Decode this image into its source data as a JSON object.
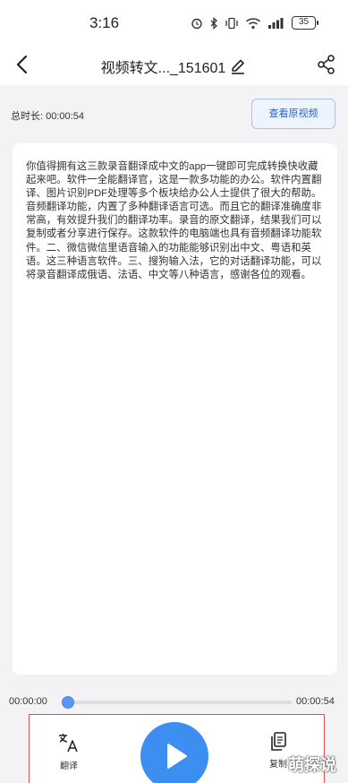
{
  "status_bar": {
    "time": "3:16",
    "icons": [
      "alarm-icon",
      "bluetooth-icon",
      "vibrate-icon",
      "wifi-icon",
      "signal-icon"
    ],
    "battery": "35"
  },
  "header": {
    "title": "视频转文..._151601",
    "icons": [
      "back-arrow-icon",
      "edit-pencil-icon",
      "share-icon"
    ]
  },
  "info": {
    "duration": "总时长: 00:00:54",
    "original_video_button": "查看原视频"
  },
  "transcript": {
    "text": "你值得拥有这三款录音翻译成中文的app一键即可完成转换快收藏起来吧。软件一全能翻译官，这是一款多功能的办公。软件内置翻译、图片识别PDF处理等多个板块给办公人士提供了很大的帮助。音频翻译功能，内置了多种翻译语言可选。而且它的翻译准确度非常高，有效提升我们的翻译功率。录音的原文翻译，结果我们可以复制或者分享进行保存。这款软件的电脑端也具有音频翻译功能软件。二、微信微信里语音输入的功能能够识别出中文、粤语和英语。这三种语言软件。三、搜狗输入法，它的对话翻译功能，可以将录音翻译成俄语、法语、中文等八种语言，感谢各位的观看。"
  },
  "player": {
    "current_time": "00:00:00",
    "total_time": "00:00:54",
    "progress": 0.0
  },
  "actions": {
    "translate_label": "翻译",
    "copy_label": "复制"
  },
  "watermark": "萌探说",
  "colors": {
    "accent": "#3d8ef1",
    "button_text": "#2f63c2",
    "highlight_border": "#e05050"
  }
}
